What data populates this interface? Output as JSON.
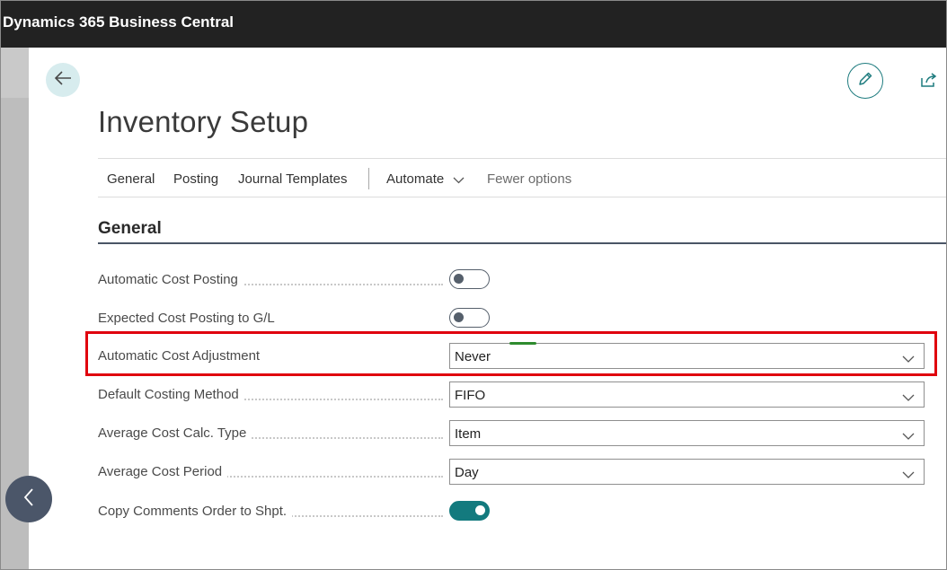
{
  "app": {
    "title": "Dynamics 365 Business Central"
  },
  "header": {
    "back_icon": "arrow-left-icon",
    "edit_icon": "pencil-icon",
    "share_icon": "share-icon"
  },
  "page": {
    "title": "Inventory Setup"
  },
  "actions": {
    "general": "General",
    "posting": "Posting",
    "journal_templates": "Journal Templates",
    "automate": "Automate",
    "fewer_options": "Fewer options"
  },
  "section": {
    "title": "General"
  },
  "fields": [
    {
      "label": "Automatic Cost Posting",
      "type": "toggle",
      "value": "off"
    },
    {
      "label": "Expected Cost Posting to G/L",
      "type": "toggle",
      "value": "off"
    },
    {
      "label": "Automatic Cost Adjustment",
      "type": "select",
      "value": "Never"
    },
    {
      "label": "Default Costing Method",
      "type": "select",
      "value": "FIFO"
    },
    {
      "label": "Average Cost Calc. Type",
      "type": "select",
      "value": "Item"
    },
    {
      "label": "Average Cost Period",
      "type": "select",
      "value": "Day"
    },
    {
      "label": "Copy Comments Order to Shpt.",
      "type": "toggle",
      "value": "on"
    }
  ],
  "colors": {
    "accent": "#137a7e",
    "highlight": "#e0000e",
    "topbar": "#222222"
  }
}
